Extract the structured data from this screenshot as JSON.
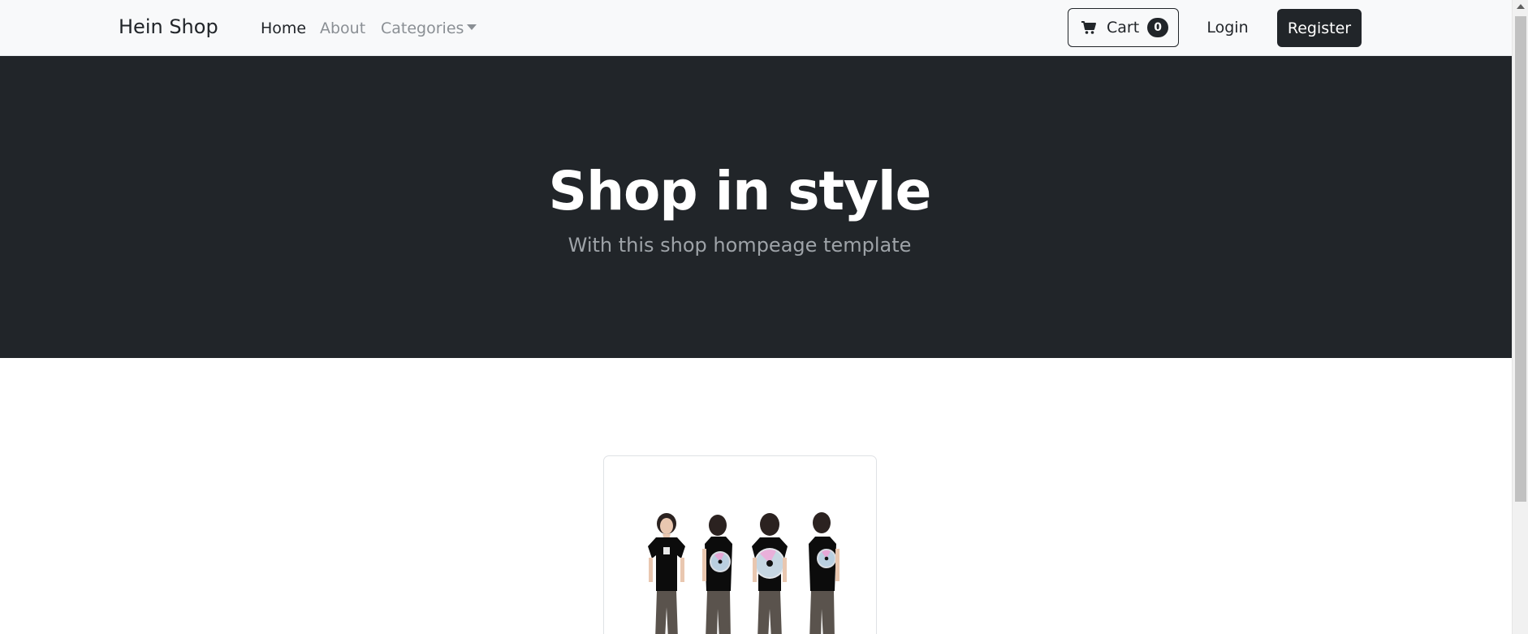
{
  "navbar": {
    "brand": "Hein Shop",
    "links": {
      "home": "Home",
      "about": "About",
      "categories": "Categories"
    },
    "cart": {
      "label": "Cart",
      "count": "0"
    },
    "login": "Login",
    "register": "Register"
  },
  "hero": {
    "title": "Shop in style",
    "subtitle": "With this shop hompeage template"
  },
  "icons": {
    "cart": "cart-icon",
    "caret": "caret-down-icon"
  },
  "colors": {
    "dark": "#212529",
    "navbar_bg": "#f8f9fa",
    "muted": "#9ea3a8"
  }
}
